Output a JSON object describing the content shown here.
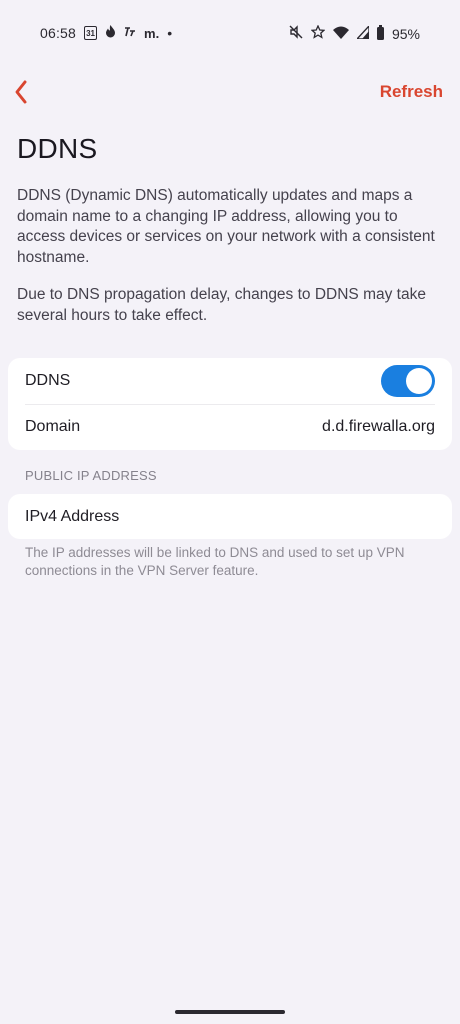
{
  "status_bar": {
    "time": "06:58",
    "calendar_day": "31",
    "app_glyph": "m.",
    "dot": "•",
    "battery": "95%",
    "icons": [
      "calendar-icon",
      "fire-icon",
      "hourglass-icon",
      "mute-icon",
      "star-icon",
      "wifi-icon",
      "signal-icon",
      "battery-icon"
    ]
  },
  "nav": {
    "refresh_label": "Refresh",
    "accent_color": "#d94630"
  },
  "page": {
    "title": "DDNS",
    "description_1": "DDNS (Dynamic DNS) automatically updates and maps a domain name to a changing IP address, allowing you to access devices or services on your network with a consistent hostname.",
    "description_2": "Due to DNS propagation delay, changes to DDNS may take several hours to take effect."
  },
  "ddns_card": {
    "ddns_label": "DDNS",
    "ddns_enabled": true,
    "toggle_color": "#1a7fe0",
    "domain_label": "Domain",
    "domain_value": "d.d.firewalla.org"
  },
  "public_ip": {
    "section_header": "PUBLIC IP ADDRESS",
    "ipv4_label": "IPv4 Address",
    "footnote": "The IP addresses will be linked to DNS and used to set up VPN connections in the VPN Server feature."
  }
}
